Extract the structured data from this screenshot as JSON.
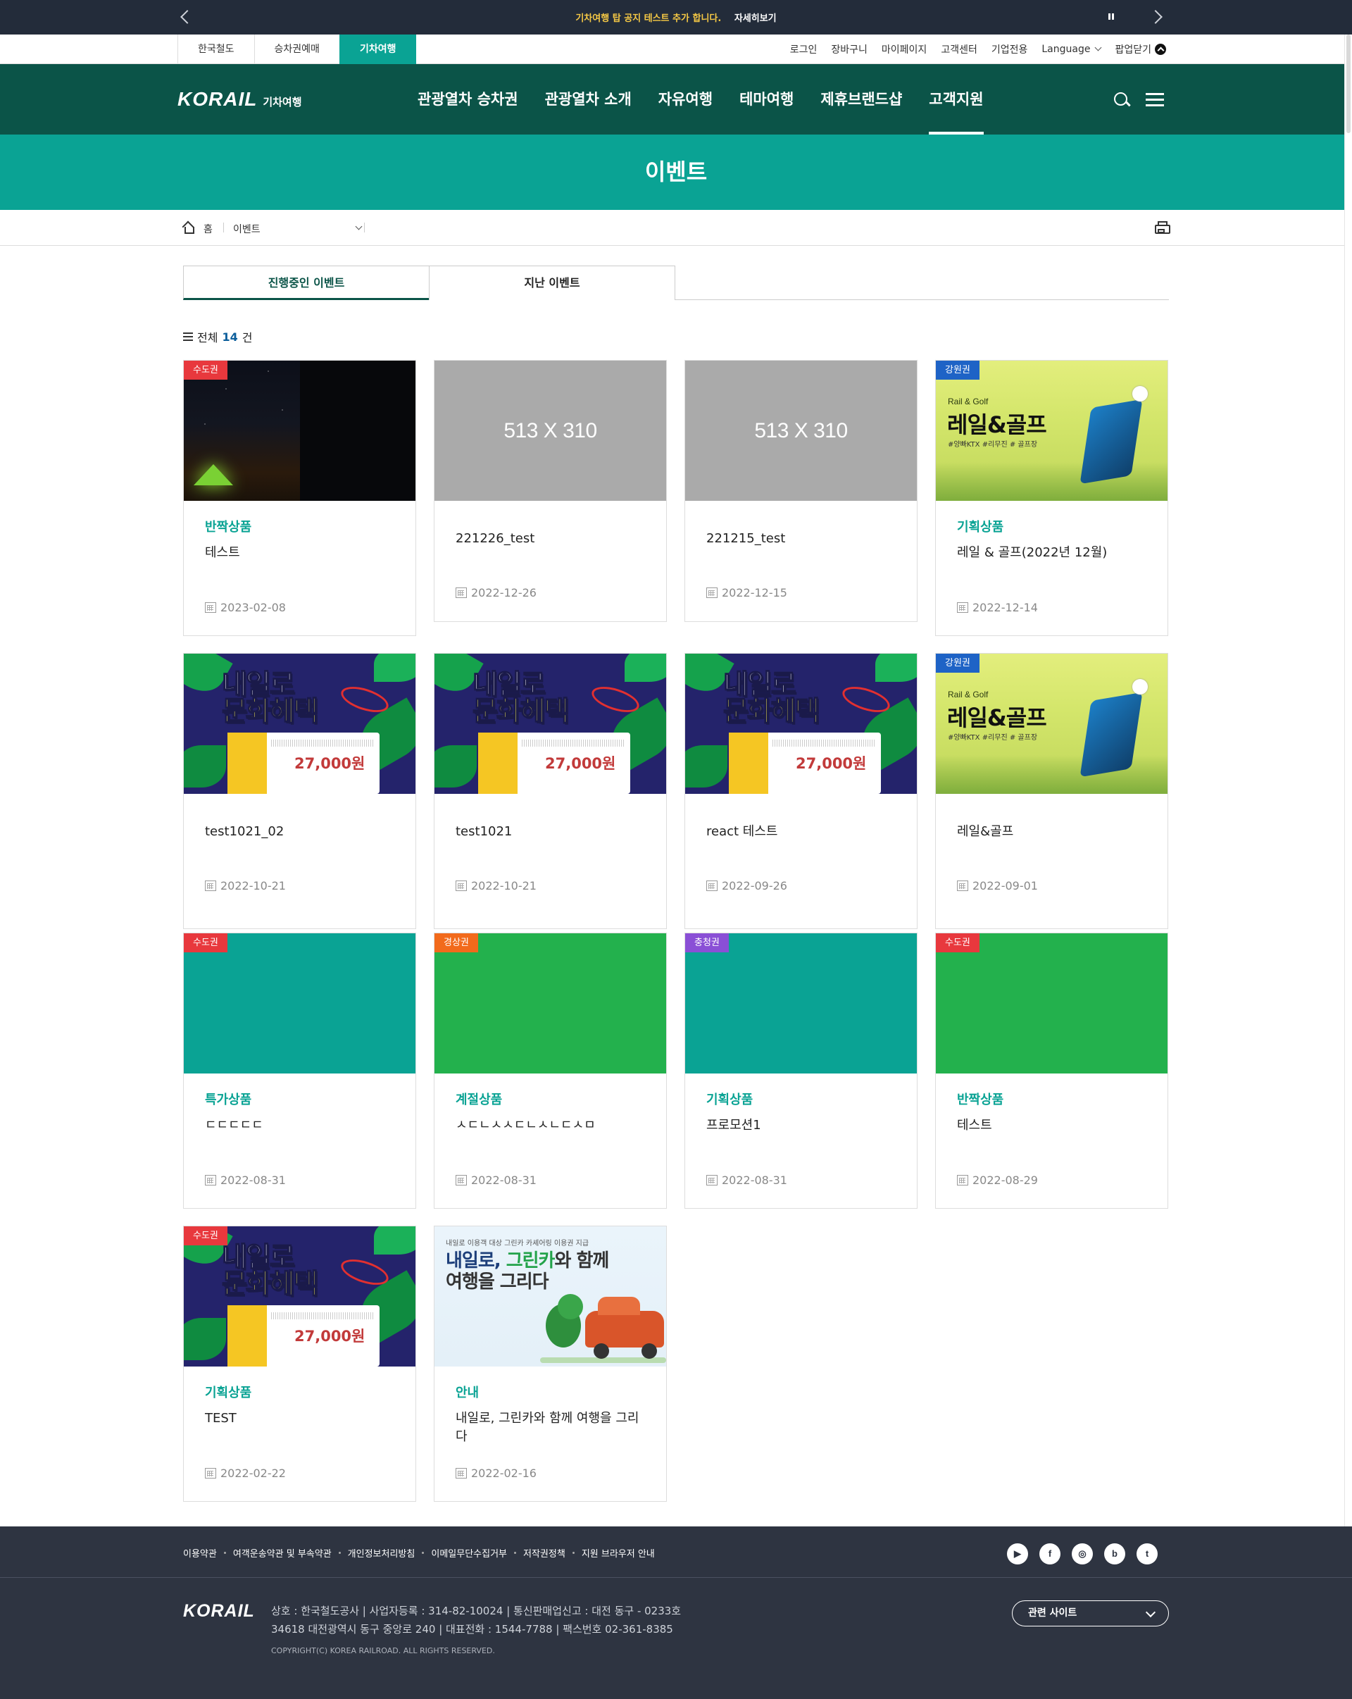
{
  "notice": {
    "message": "기차여행 탑 공지 테스트 추가 합니다.",
    "more_label": "자세히보기"
  },
  "util": {
    "site_tabs": [
      "한국철도",
      "승차권예매",
      "기차여행"
    ],
    "links": [
      "로그인",
      "장바구니",
      "마이페이지",
      "고객센터",
      "기업전용"
    ],
    "language": "Language",
    "close_popup": "팝업닫기"
  },
  "gnb": {
    "logo": "KORAIL",
    "logo_sub": "기차여행",
    "menu": [
      "관광열차 승차권",
      "관광열차 소개",
      "자유여행",
      "테마여행",
      "제휴브랜드샵",
      "고객지원"
    ],
    "active_menu": "고객지원"
  },
  "page": {
    "title": "이벤트"
  },
  "breadcrumb": {
    "home": "홈",
    "current": "이벤트"
  },
  "tabs": [
    "진행중인 이벤트",
    "지난 이벤트"
  ],
  "count": {
    "prefix": "전체",
    "value": "14",
    "suffix": "건"
  },
  "placeholder_text": "513 X 310",
  "banners": {
    "golf_en": "Rail & Golf",
    "golf_title": "레일&골프",
    "golf_tags": "#양빠KTX #리무진 # 골프장",
    "culture_line1": "내일로",
    "culture_line2": "문화혜택",
    "culture_price": "27,000원",
    "greencar_small": "내일로 이용객 대상 그린카 카셰어링 이용권 지급",
    "greencar_line1_a": "내일로, ",
    "greencar_line1_b": "그린카",
    "greencar_line1_c": "와 함께",
    "greencar_line2": "여행을 그리다"
  },
  "events": [
    {
      "region": "수도권",
      "region_color": "#e8383d",
      "category": "반짝상품",
      "title": "테스트",
      "date": "2023-02-08",
      "thumb": "night"
    },
    {
      "region": "",
      "category": "",
      "title": "221226_test",
      "date": "2022-12-26",
      "thumb": "placeholder"
    },
    {
      "region": "",
      "category": "",
      "title": "221215_test",
      "date": "2022-12-15",
      "thumb": "placeholder"
    },
    {
      "region": "강원권",
      "region_color": "#1e63c6",
      "category": "기획상품",
      "title": "레일 & 골프(2022년 12월)",
      "date": "2022-12-14",
      "thumb": "golf"
    },
    {
      "region": "",
      "category": "",
      "title": "test1021_02",
      "date": "2022-10-21",
      "thumb": "jungle"
    },
    {
      "region": "",
      "category": "",
      "title": "test1021",
      "date": "2022-10-21",
      "thumb": "jungle"
    },
    {
      "region": "",
      "category": "",
      "title": "react 테스트",
      "date": "2022-09-26",
      "thumb": "jungle"
    },
    {
      "region": "강원권",
      "region_color": "#1e63c6",
      "category": "",
      "title": "레일&골프",
      "date": "2022-09-01",
      "thumb": "golf"
    },
    {
      "region": "수도권",
      "region_color": "#e8383d",
      "category": "특가상품",
      "title": "ㄷㄷㄷㄷㄷ",
      "date": "2022-08-31",
      "thumb": "teal"
    },
    {
      "region": "경상권",
      "region_color": "#f26a1b",
      "category": "계절상품",
      "title": "ㅅㄷㄴㅅㅅㄷㄴㅅㄴㄷㅅㅁ",
      "date": "2022-08-31",
      "thumb": "green"
    },
    {
      "region": "충청권",
      "region_color": "#8a4fd6",
      "category": "기획상품",
      "title": "프로모션1",
      "date": "2022-08-31",
      "thumb": "teal"
    },
    {
      "region": "수도권",
      "region_color": "#e8383d",
      "category": "반짝상품",
      "title": "테스트",
      "date": "2022-08-29",
      "thumb": "green"
    },
    {
      "region": "수도권",
      "region_color": "#e8383d",
      "category": "기획상품",
      "title": "TEST",
      "date": "2022-02-22",
      "thumb": "jungle"
    },
    {
      "region": "",
      "category": "안내",
      "title": "내일로, 그린카와 함께 여행을 그리다",
      "date": "2022-02-16",
      "thumb": "greencar"
    }
  ],
  "footer": {
    "links": [
      "이용약관",
      "여객운송약관 및 부속약관",
      "개인정보처리방침",
      "이메일무단수집거부",
      "저작권정책",
      "지원 브라우저 안내"
    ],
    "sns": [
      "youtube-icon",
      "facebook-icon",
      "instagram-icon",
      "blog-icon",
      "twitter-icon"
    ],
    "logo": "KORAIL",
    "info_line1": "상호 : 한국철도공사 | 사업자등록 : 314-82-10024 | 통신판매업신고 : 대전 동구 - 0233호",
    "info_line2": "34618 대전광역시 동구 중앙로 240 | 대표전화 : 1544-7788 | 팩스번호 02-361-8385",
    "copyright": "COPYRIGHT(C) KOREA RAILROAD. ALL RIGHTS RESERVED.",
    "related_site": "관련 사이트"
  }
}
